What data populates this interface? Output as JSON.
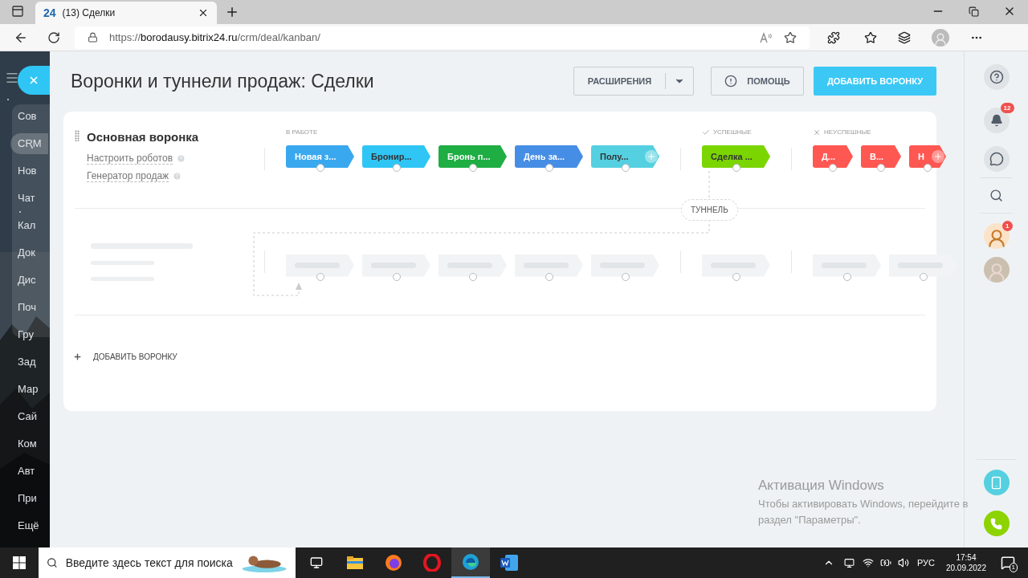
{
  "browser": {
    "tab_logo": "24",
    "tab_title": "(13) Сделки",
    "url_scheme": "https://",
    "url_host": "borodausy.bitrix24.ru",
    "url_path": "/crm/deal/kanban/"
  },
  "left_menu": [
    {
      "label": "Сов",
      "selected": false
    },
    {
      "label": "CRM",
      "selected": true
    },
    {
      "label": "Нов",
      "selected": false
    },
    {
      "label": "Чат",
      "selected": false
    },
    {
      "label": "Кал",
      "selected": false
    },
    {
      "label": "Док",
      "selected": false
    },
    {
      "label": "Дис",
      "selected": false
    },
    {
      "label": "Поч",
      "selected": false
    },
    {
      "label": "Гру",
      "selected": false
    },
    {
      "label": "Зад",
      "selected": false
    },
    {
      "label": "Мар",
      "selected": false
    },
    {
      "label": "Сай",
      "selected": false
    },
    {
      "label": "Ком",
      "selected": false
    },
    {
      "label": "Авт",
      "selected": false
    },
    {
      "label": "При",
      "selected": false
    },
    {
      "label": "Ещё",
      "selected": false
    }
  ],
  "page": {
    "title": "Воронки и туннели продаж: Сделки",
    "extensions_button": "РАСШИРЕНИЯ",
    "help_button": "ПОМОЩЬ",
    "add_button": "ДОБАВИТЬ ВОРОНКУ"
  },
  "funnel": {
    "name": "Основная воронка",
    "links": [
      "Настроить роботов",
      "Генератор продаж"
    ],
    "groups": [
      {
        "kind": "progress",
        "title": "В РАБОТЕ",
        "stages": [
          {
            "name": "Новая з...",
            "color": "#39a8ef",
            "add": false
          },
          {
            "name": "Бронир...",
            "color": "#2fc6f6",
            "add": false
          },
          {
            "name": "Бронь п...",
            "color": "#1eae43",
            "add": false
          },
          {
            "name": "День за...",
            "color": "#468ee5",
            "add": false
          },
          {
            "name": "Полу...",
            "color": "#55d0e0",
            "add": true
          }
        ]
      },
      {
        "kind": "success",
        "title": "УСПЕШНЫЕ",
        "stages": [
          {
            "name": "Сделка ...",
            "color": "#7bd500",
            "add": false
          }
        ]
      },
      {
        "kind": "failure",
        "title": "НЕУСПЕШНЫЕ",
        "stages": [
          {
            "name": "Д...",
            "color": "#ff5752",
            "add": false
          },
          {
            "name": "В...",
            "color": "#ff5752",
            "add": false
          },
          {
            "name": "Н",
            "color": "#ff5752",
            "add": true
          }
        ]
      }
    ]
  },
  "tunnel_label": "ТУННЕЛЬ",
  "add_funnel": "ДОБАВИТЬ ВОРОНКУ",
  "right_bar": {
    "notifications_badge": "12",
    "chat_badge": "1"
  },
  "activation": {
    "title": "Активация Windows",
    "text": "Чтобы активировать Windows, перейдите в раздел \"Параметры\"."
  },
  "taskbar": {
    "search_placeholder": "Введите здесь текст для поиска",
    "apps": [
      {
        "kind": "taskview",
        "selected": false
      },
      {
        "kind": "explorer",
        "selected": false
      },
      {
        "kind": "firefox",
        "selected": false
      },
      {
        "kind": "opera",
        "selected": false
      },
      {
        "kind": "edge",
        "selected": true
      },
      {
        "kind": "word",
        "selected": false
      }
    ],
    "language": "РУС",
    "time": "17:54",
    "date": "20.09.2022",
    "notifications": "1"
  }
}
